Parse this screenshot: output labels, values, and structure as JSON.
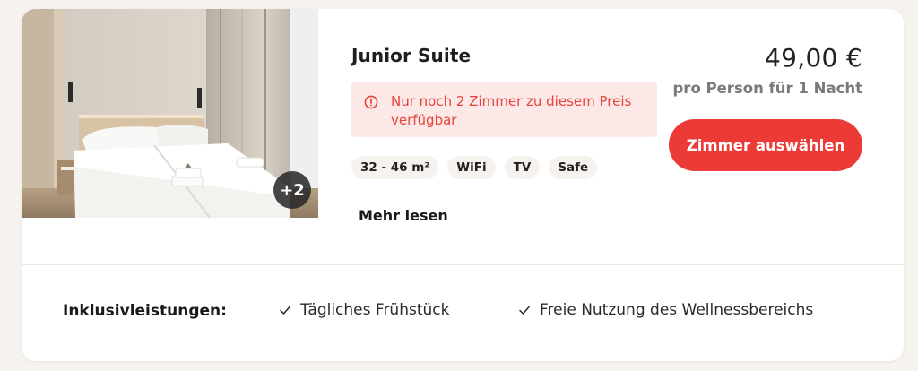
{
  "room": {
    "title": "Junior Suite",
    "photo_more_count": "+2",
    "alert_text": "Nur noch 2 Zimmer zu diesem Preis verfügbar",
    "amenities": [
      "32 - 46 m²",
      "WiFi",
      "TV",
      "Safe"
    ],
    "read_more_label": "Mehr lesen"
  },
  "pricing": {
    "price": "49,00 €",
    "per_unit": "pro Person für 1 Nacht",
    "select_button_label": "Zimmer auswählen"
  },
  "inclusions": {
    "label": "Inklusivleistungen:",
    "items": [
      "Tägliches Frühstück",
      "Freie Nutzung des Wellnessbereichs"
    ]
  },
  "colors": {
    "accent": "#ec3b36",
    "alert_bg": "#fde8e8",
    "alert_text": "#e8423b",
    "chip_bg": "#f6f2ee"
  },
  "icons": [
    "room-photo",
    "alert-circle-icon",
    "check-icon"
  ]
}
